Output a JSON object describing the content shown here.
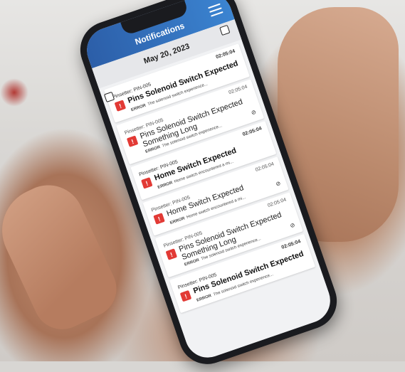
{
  "app": {
    "title": "Notifications"
  },
  "date": "May 20, 2023",
  "notifications": [
    {
      "time": "02:05:04",
      "source": "Pinsetter: PIN-005",
      "title": "Pins Solenoid Switch Expected",
      "level": "ERROR",
      "message": "The solenoid switch experience..."
    },
    {
      "time": "02:05:04",
      "source": "Pinsetter: PIN-005",
      "title": "Pins Solenoid Switch Expected Something Long",
      "level": "ERROR",
      "message": "The solenoid switch experience..."
    },
    {
      "time": "02:05:04",
      "source": "Pinsetter: PIN-005",
      "title": "Home Switch Expected",
      "level": "ERROR",
      "message": "Home switch encountered a mi..."
    },
    {
      "time": "02:05:04",
      "source": "Pinsetter: PIN-005",
      "title": "Home Switch Expected",
      "level": "ERROR",
      "message": "Home switch encountered a mi..."
    },
    {
      "time": "02:05:04",
      "source": "Pinsetter: PIN-005",
      "title": "Pins Solenoid Switch Expected Something Long",
      "level": "ERROR",
      "message": "The solenoid switch experience..."
    },
    {
      "time": "02:05:04",
      "source": "Pinsetter: PIN-005",
      "title": "Pins Solenoid Switch Expected",
      "level": "ERROR",
      "message": "The solenoid switch experience..."
    }
  ],
  "icons": {
    "menu": "hamburger-icon",
    "error": "exclamation-icon",
    "read": "check-circle-icon"
  },
  "colors": {
    "header": "#2c5ea8",
    "error": "#e23a35"
  }
}
